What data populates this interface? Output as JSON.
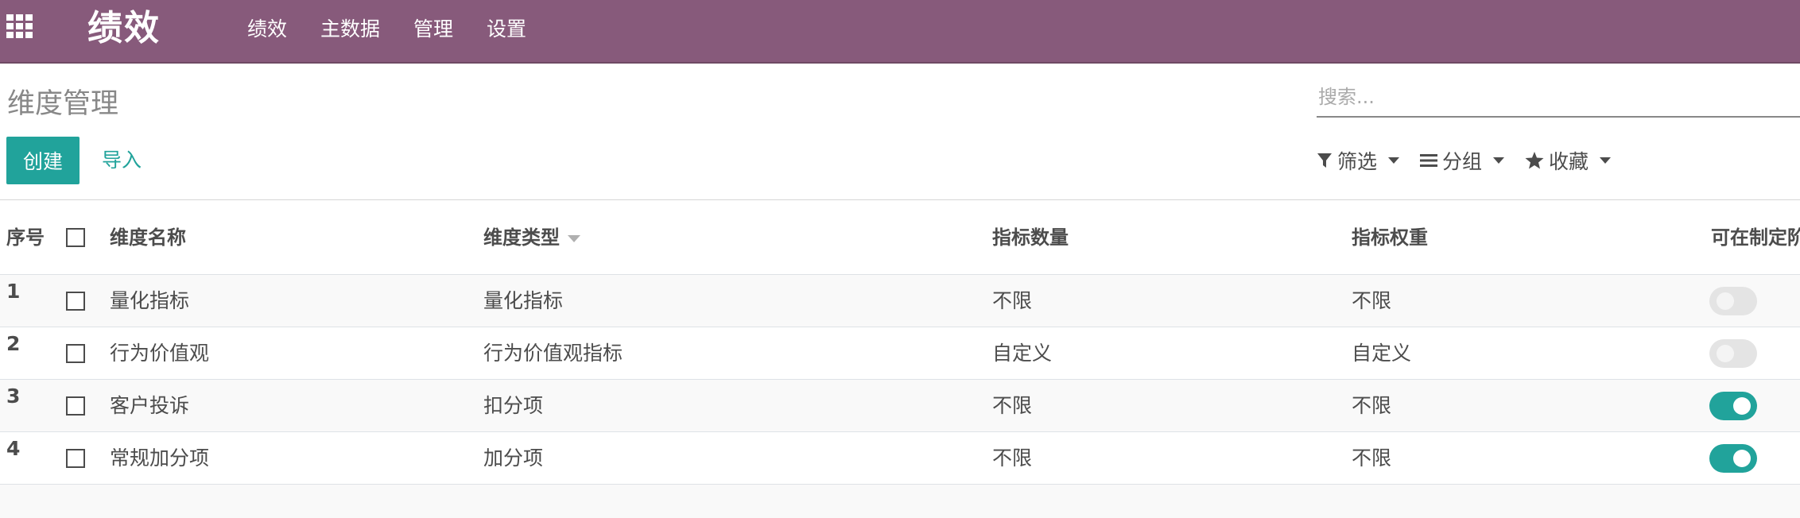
{
  "navbar": {
    "brand": "绩效",
    "menu": [
      "绩效",
      "主数据",
      "管理",
      "设置"
    ],
    "color": "#875a7b"
  },
  "control_panel": {
    "breadcrumb": "维度管理",
    "search_placeholder": "搜索...",
    "create_label": "创建",
    "import_label": "导入",
    "filter_label": "筛选",
    "group_label": "分组",
    "favorite_label": "收藏",
    "accent_color": "#21a39b"
  },
  "table": {
    "headers": {
      "seq": "序号",
      "name": "维度名称",
      "type": "维度类型",
      "count": "指标数量",
      "weight": "指标权重",
      "editable": "可在制定阶"
    },
    "rows": [
      {
        "seq": "1",
        "name": "量化指标",
        "type": "量化指标",
        "count": "不限",
        "weight": "不限",
        "editable": false
      },
      {
        "seq": "2",
        "name": "行为价值观",
        "type": "行为价值观指标",
        "count": "自定义",
        "weight": "自定义",
        "editable": false
      },
      {
        "seq": "3",
        "name": "客户投诉",
        "type": "扣分项",
        "count": "不限",
        "weight": "不限",
        "editable": true
      },
      {
        "seq": "4",
        "name": "常规加分项",
        "type": "加分项",
        "count": "不限",
        "weight": "不限",
        "editable": true
      }
    ]
  }
}
